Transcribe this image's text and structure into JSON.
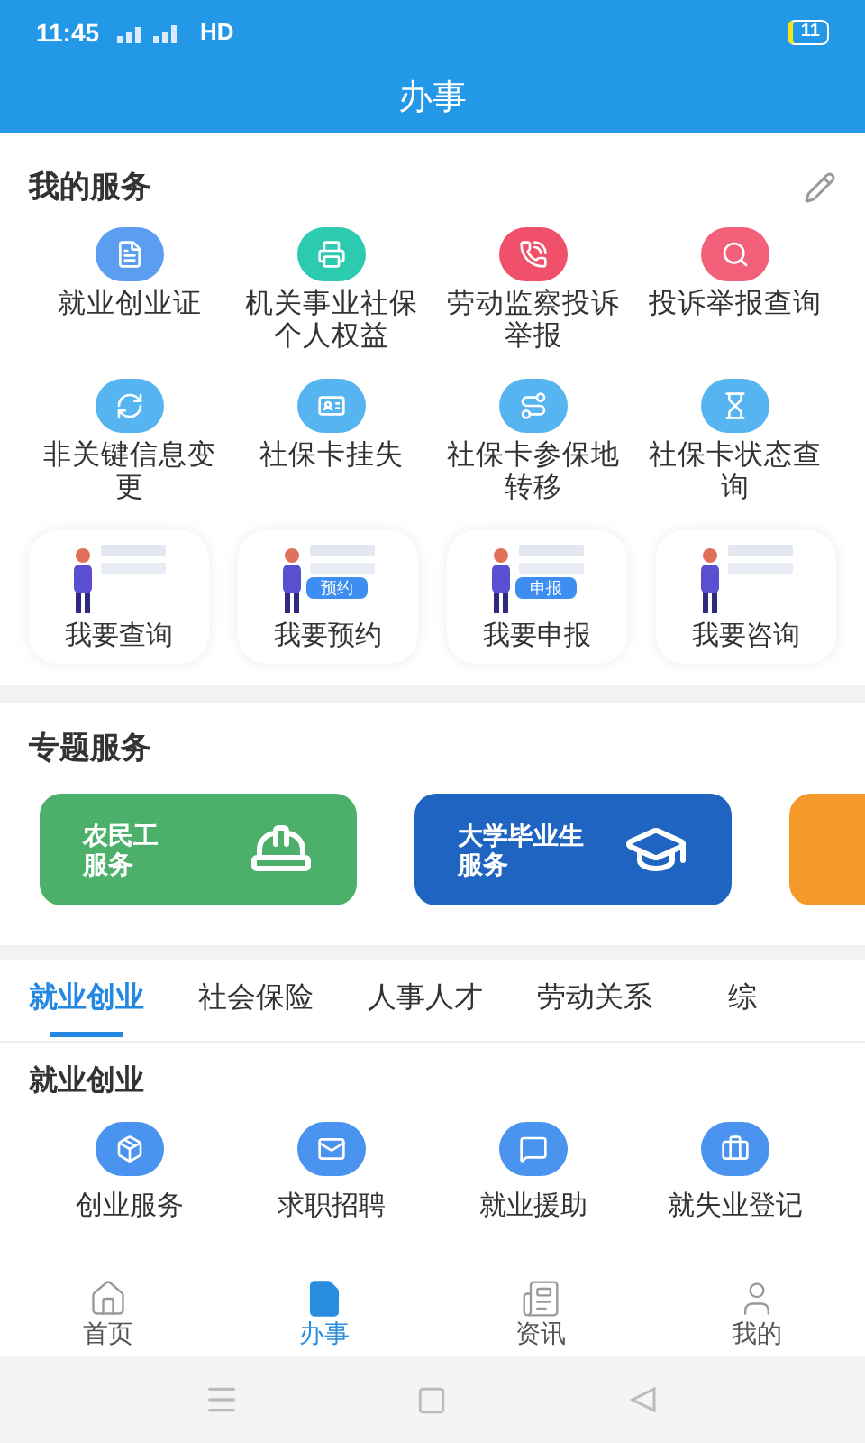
{
  "status_bar": {
    "time": "11:45",
    "network": "HD",
    "battery": "11"
  },
  "header": {
    "title": "办事"
  },
  "my_services": {
    "title": "我的服务",
    "items": [
      {
        "label": "就业创业证",
        "color": "#5b9ef0"
      },
      {
        "label": "机关事业社保个人权益",
        "color": "#2ccbb0"
      },
      {
        "label": "劳动监察投诉举报",
        "color": "#f0506a"
      },
      {
        "label": "投诉举报查询",
        "color": "#f2607a"
      },
      {
        "label": "非关键信息变更",
        "color": "#56b4f0"
      },
      {
        "label": "社保卡挂失",
        "color": "#56b4f0"
      },
      {
        "label": "社保卡参保地转移",
        "color": "#56b4f0"
      },
      {
        "label": "社保卡状态查询",
        "color": "#56b4f0"
      }
    ],
    "quick_cards": [
      {
        "label": "我要查询"
      },
      {
        "label": "我要预约",
        "tag": "预约"
      },
      {
        "label": "我要申报",
        "tag": "申报"
      },
      {
        "label": "我要咨询"
      }
    ]
  },
  "topics": {
    "title": "专题服务",
    "banners": [
      {
        "lines": [
          "农民工",
          "服务"
        ],
        "color": "#4caf6a"
      },
      {
        "lines": [
          "大学毕业生",
          "服务"
        ],
        "color": "#1e64c0"
      },
      {
        "color": "#f59a2a"
      }
    ]
  },
  "category_tabs": [
    {
      "label": "就业创业",
      "selected": true
    },
    {
      "label": "社会保险",
      "selected": false
    },
    {
      "label": "人事人才",
      "selected": false
    },
    {
      "label": "劳动关系",
      "selected": false
    },
    {
      "label": "综",
      "selected": false
    }
  ],
  "category_section": {
    "title": "就业创业",
    "items": [
      {
        "label": "创业服务"
      },
      {
        "label": "求职招聘"
      },
      {
        "label": "就业援助"
      },
      {
        "label": "就失业登记"
      }
    ]
  },
  "bottom_nav": [
    {
      "label": "首页",
      "selected": false
    },
    {
      "label": "办事",
      "selected": true
    },
    {
      "label": "资讯",
      "selected": false
    },
    {
      "label": "我的",
      "selected": false
    }
  ]
}
